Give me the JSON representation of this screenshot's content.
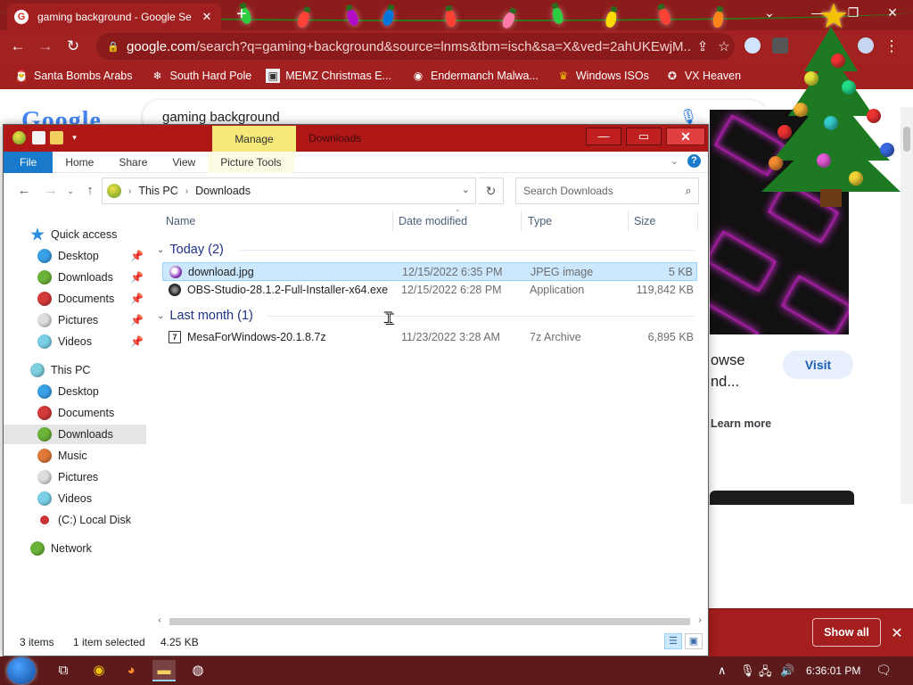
{
  "browser": {
    "tab_title": "gaming background - Google Se",
    "tab_close": "✕",
    "new_tab": "+",
    "window_controls": {
      "minimize": "—",
      "restore": "❐",
      "close": "✕"
    },
    "url_host": "google.com",
    "url_rest": "/search?q=gaming+background&source=lnms&tbm=isch&sa=X&ved=2ahUKEwjM...",
    "bookmarks": [
      {
        "label": "Santa Bombs Arabs",
        "icon": "santa-icon"
      },
      {
        "label": "South Hard Pole",
        "icon": "snowflake-icon"
      },
      {
        "label": "MEMZ Christmas E...",
        "icon": "memz-icon"
      },
      {
        "label": "Endermanch Malwa...",
        "icon": "raccoon-icon"
      },
      {
        "label": "Windows ISOs",
        "icon": "trophy-icon"
      },
      {
        "label": "VX Heaven",
        "icon": "vx-icon"
      }
    ]
  },
  "google": {
    "logo": "Google",
    "search_query": "gaming background",
    "panel_text": "owse nd...",
    "visit_label": "Visit",
    "learn_more": "Learn more",
    "download_bar": {
      "show_all": "Show all",
      "close": "✕"
    }
  },
  "explorer": {
    "title": "Downloads",
    "context_tab": "Manage",
    "ribbon_tabs": [
      "File",
      "Home",
      "Share",
      "View",
      "Picture Tools"
    ],
    "close_glyph": "✕",
    "help": "?",
    "address": {
      "crumbs": [
        "This PC",
        "Downloads"
      ]
    },
    "search_placeholder": "Search Downloads",
    "nav": {
      "quick_access": "Quick access",
      "quick_items": [
        "Desktop",
        "Downloads",
        "Documents",
        "Pictures",
        "Videos"
      ],
      "this_pc": "This PC",
      "pc_items": [
        "Desktop",
        "Documents",
        "Downloads",
        "Music",
        "Pictures",
        "Videos",
        "(C:) Local Disk"
      ],
      "network": "Network"
    },
    "columns": [
      "Name",
      "Date modified",
      "Type",
      "Size"
    ],
    "groups": [
      {
        "label": "Today (2)",
        "files": [
          {
            "name": "download.jpg",
            "date": "12/15/2022 6:35 PM",
            "type": "JPEG image",
            "size": "5 KB",
            "selected": true
          },
          {
            "name": "OBS-Studio-28.1.2-Full-Installer-x64.exe",
            "date": "12/15/2022 6:28 PM",
            "type": "Application",
            "size": "119,842 KB",
            "selected": false
          }
        ]
      },
      {
        "label": "Last month (1)",
        "files": [
          {
            "name": "MesaForWindows-20.1.8.7z",
            "date": "11/23/2022 3:28 AM",
            "type": "7z Archive",
            "size": "6,895 KB",
            "selected": false
          }
        ]
      }
    ],
    "status": {
      "items": "3 items",
      "selected": "1 item selected",
      "size": "4.25 KB"
    }
  },
  "taskbar": {
    "clock": "6:36:01 PM",
    "apps": [
      "task-view-icon",
      "chrome-icon",
      "firefox-icon",
      "file-explorer-icon",
      "obs-icon"
    ]
  },
  "colors": {
    "chrome_red": "#a22222",
    "explorer_title": "#b01818",
    "file_tab_blue": "#1979ca",
    "selection": "#cce8ff",
    "taskbar": "#5c1a1a"
  }
}
